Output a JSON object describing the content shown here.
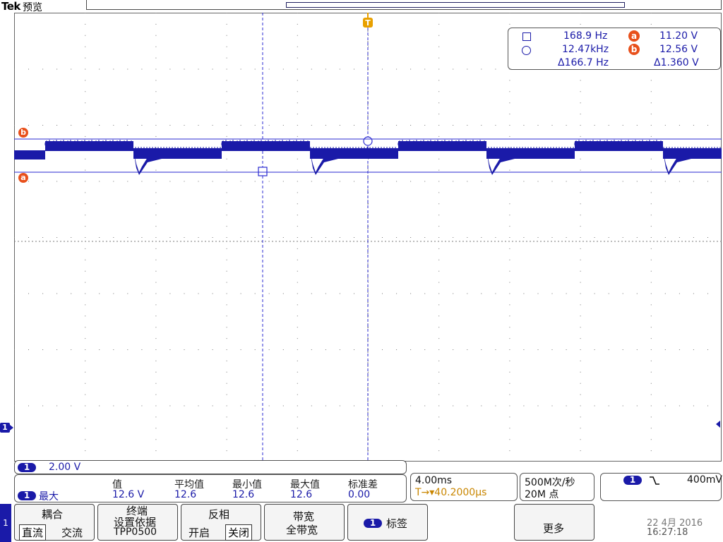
{
  "header": {
    "brand": "Tek",
    "mode": "预览"
  },
  "trigger_marker": "T",
  "cursor_readout": {
    "row1": {
      "freq": "168.9 Hz",
      "badge": "a",
      "volt": "11.20 V"
    },
    "row2": {
      "freq": "12.47kHz",
      "badge": "b",
      "volt": "12.56 V"
    },
    "row3": {
      "delta_freq": "Δ166.7 Hz",
      "delta_volt": "Δ1.360 V"
    }
  },
  "cursor_markers": {
    "b": "b",
    "a": "a"
  },
  "channel_marker": "1",
  "ch1": {
    "badge": "1",
    "scale": "2.00 V"
  },
  "stats": {
    "badge": "1",
    "measure": "最大",
    "headers": [
      "值",
      "平均值",
      "最小值",
      "最大值",
      "标准差"
    ],
    "values": [
      "12.6 V",
      "12.6",
      "12.6",
      "12.6",
      "0.00"
    ]
  },
  "timebase": {
    "scale": "4.00ms",
    "position": "T→▾40.2000μs"
  },
  "acquisition": {
    "rate": "500M次/秒",
    "points": "20M 点"
  },
  "trigger": {
    "badge": "1",
    "slope": "⌥",
    "level": "400mV"
  },
  "menu": {
    "tab": "1",
    "coupling": {
      "title": "耦合",
      "opt1": "直流",
      "opt2": "交流"
    },
    "termination": {
      "line1": "终端",
      "line2": "设置依据",
      "line3": "TPP0500"
    },
    "invert": {
      "title": "反相",
      "opt1": "开启",
      "opt2": "关闭"
    },
    "bandwidth": {
      "title": "带宽",
      "value": "全带宽"
    },
    "label": {
      "badge": "1",
      "text": "标签"
    },
    "more": "更多"
  },
  "datetime": {
    "date": "22 4月 2016",
    "time": "16:27:18"
  },
  "colors": {
    "trace": "#1a1aa8",
    "cursor": "#2a2ad0",
    "marker": "#e8501b",
    "trigger": "#e8a000"
  }
}
